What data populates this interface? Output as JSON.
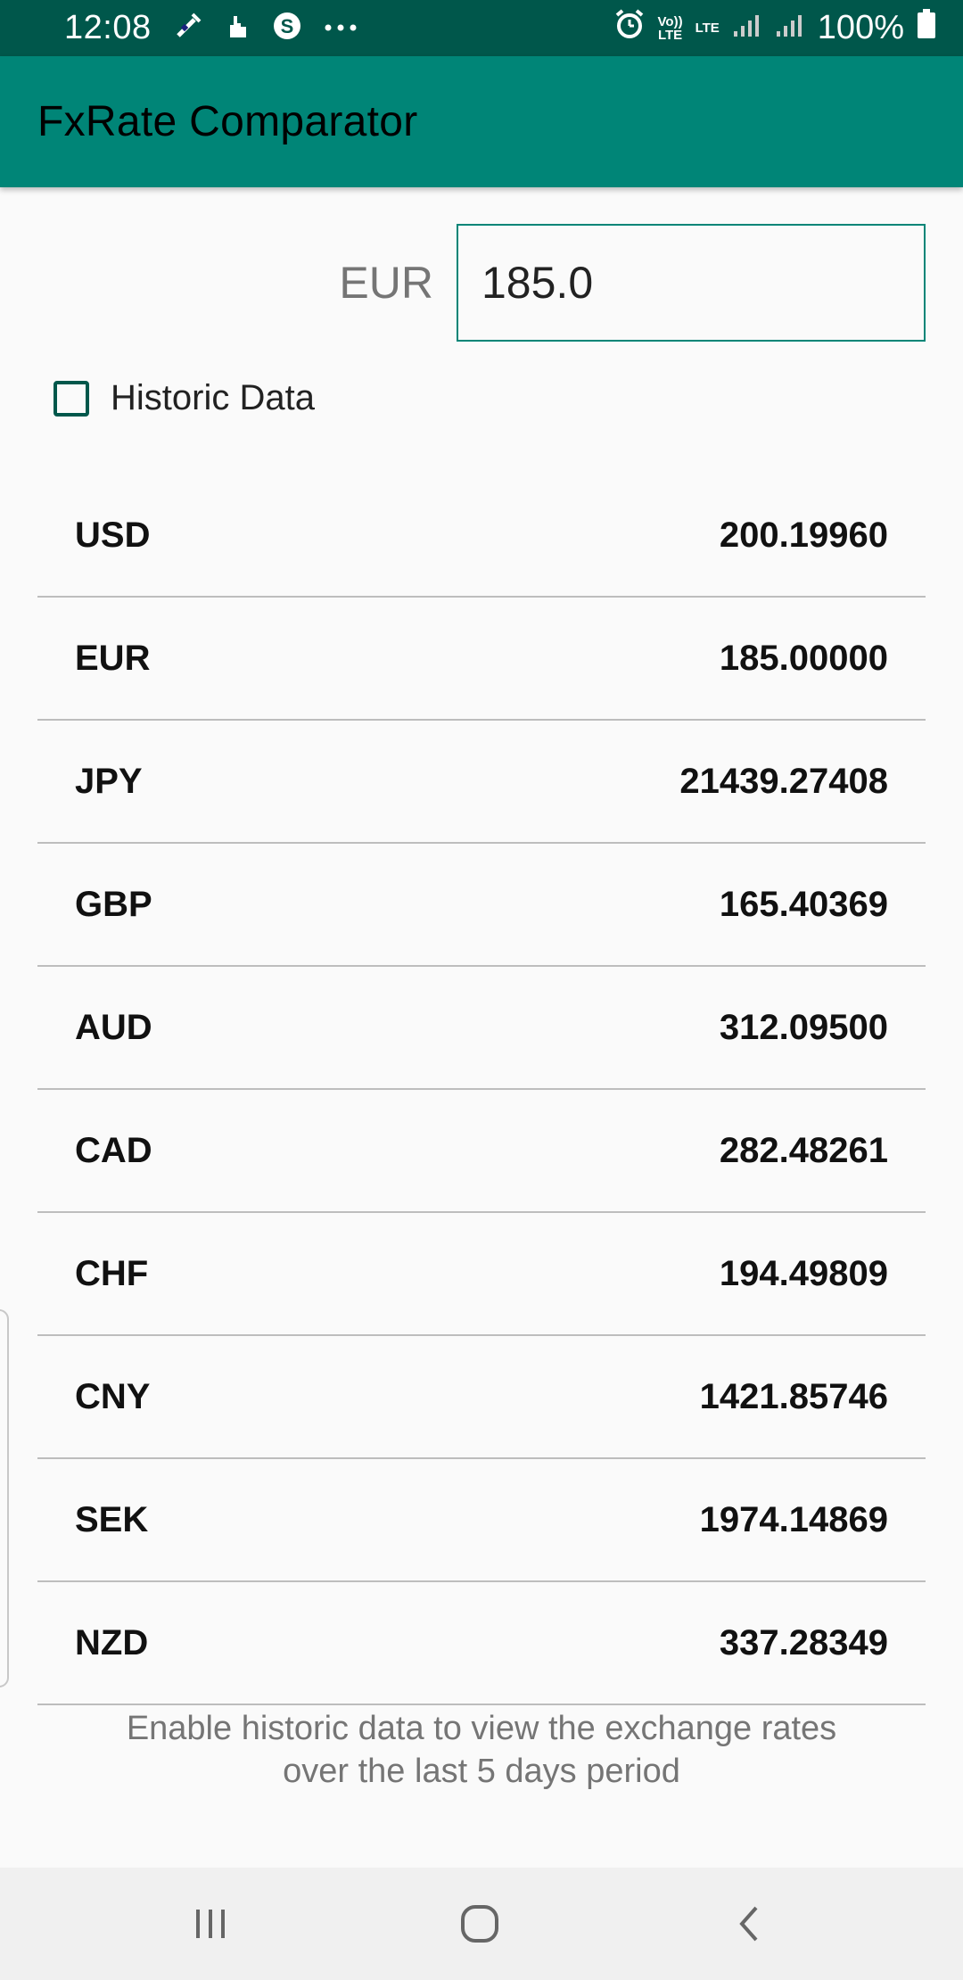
{
  "status_bar": {
    "time": "12:08",
    "left_icons": [
      "wand-icon",
      "hand-icon",
      "skype-icon",
      "more-dots-icon"
    ],
    "volte_label": "Vo))\nLTE",
    "lte_label": "LTE",
    "battery_text": "100%"
  },
  "app_bar": {
    "title": "FxRate Comparator"
  },
  "converter": {
    "base_currency": "EUR",
    "amount_value": "185.0"
  },
  "historic": {
    "label": "Historic Data",
    "checked": false
  },
  "rates": [
    {
      "code": "USD",
      "value": "200.19960"
    },
    {
      "code": "EUR",
      "value": "185.00000"
    },
    {
      "code": "JPY",
      "value": "21439.27408"
    },
    {
      "code": "GBP",
      "value": "165.40369"
    },
    {
      "code": "AUD",
      "value": "312.09500"
    },
    {
      "code": "CAD",
      "value": "282.48261"
    },
    {
      "code": "CHF",
      "value": "194.49809"
    },
    {
      "code": "CNY",
      "value": "1421.85746"
    },
    {
      "code": "SEK",
      "value": "1974.14869"
    },
    {
      "code": "NZD",
      "value": "337.28349"
    }
  ],
  "hint": {
    "line1": "Enable historic data to view the exchange rates",
    "line2": "over the last 5 days period"
  },
  "colors": {
    "primary": "#008577",
    "primary_dark": "#00574b",
    "background": "#fafafa"
  }
}
